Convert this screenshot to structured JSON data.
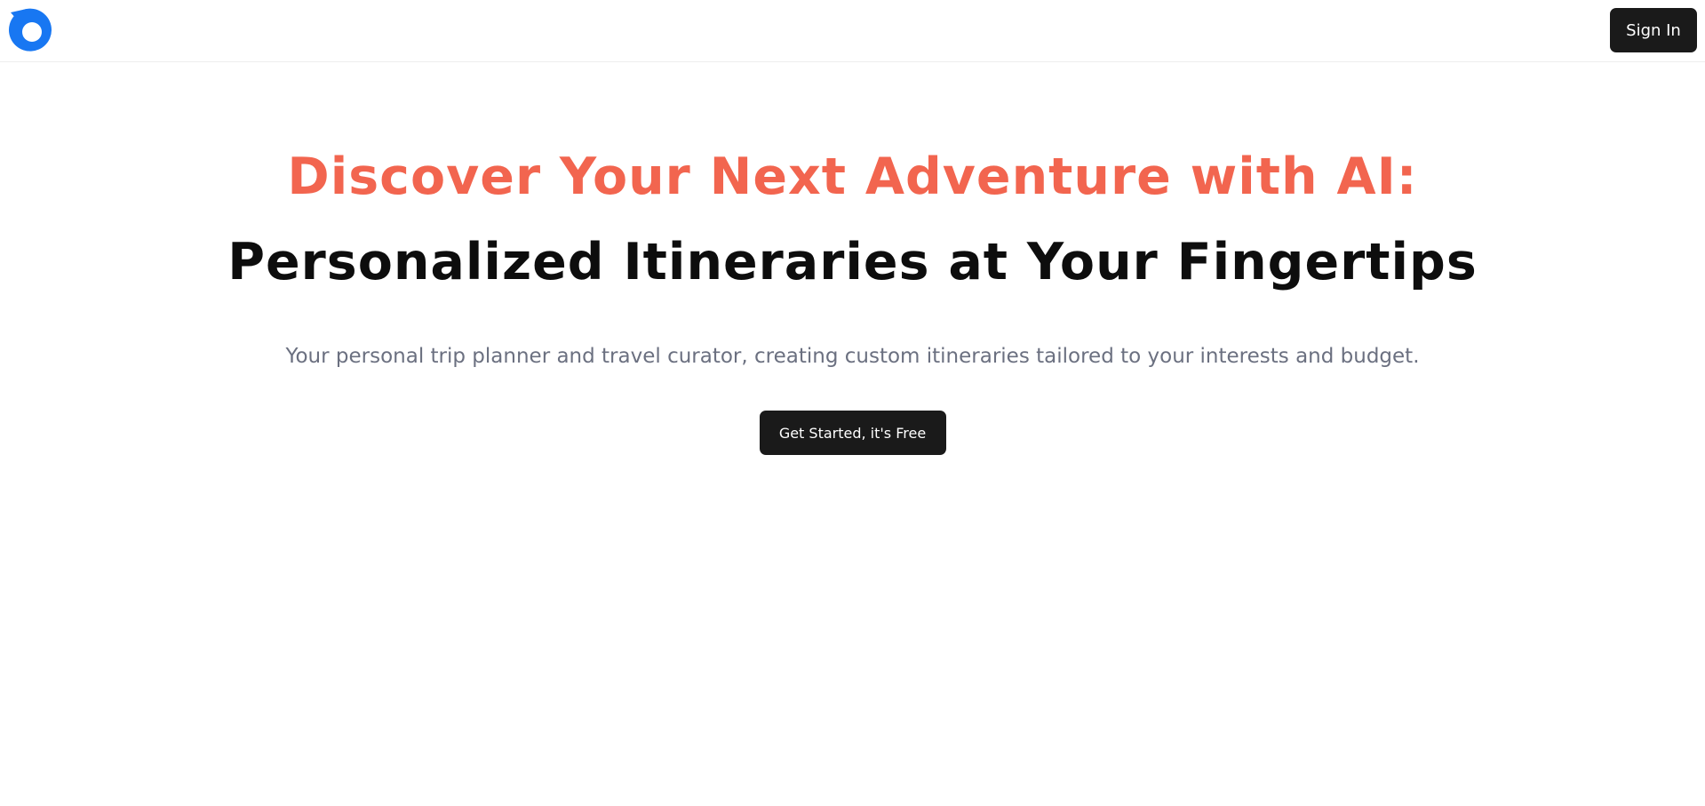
{
  "header": {
    "logo_icon": "logo-icon",
    "signin_label": "Sign In"
  },
  "hero": {
    "headline_line1": "Discover Your Next Adventure with AI:",
    "headline_line2": "Personalized Itineraries at Your Fingertips",
    "subtitle": "Your personal trip planner and travel curator, creating custom itineraries tailored to your interests and budget.",
    "cta_label": "Get Started, it's Free"
  },
  "colors": {
    "accent": "#f2654f",
    "logo_blue": "#1877f2",
    "button_bg": "#1a1a1a",
    "subtitle_gray": "#6b7080"
  }
}
